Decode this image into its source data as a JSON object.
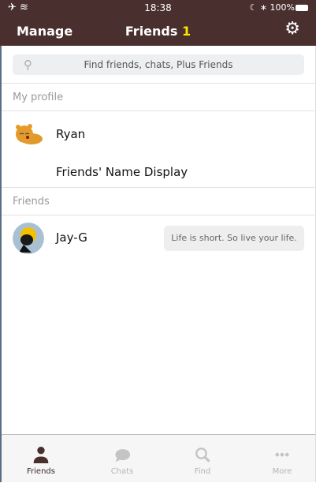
{
  "status_bar": {
    "time": "18:38",
    "battery": "100%"
  },
  "header": {
    "manage": "Manage",
    "title": "Friends",
    "count": "1",
    "accent": "#ffe600",
    "bg": "#4a2f2f"
  },
  "search": {
    "placeholder": "Find friends, chats, Plus Friends"
  },
  "my_profile": {
    "section": "My profile",
    "name": "Ryan",
    "option": "Friends' Name Display"
  },
  "friends": {
    "section": "Friends",
    "items": [
      {
        "name": "Jay-G",
        "status": "Life is short. So live your life."
      }
    ]
  },
  "tabs": [
    {
      "label": "Friends",
      "icon": "person-icon",
      "active": true
    },
    {
      "label": "Chats",
      "icon": "speech-bubble-icon"
    },
    {
      "label": "Find",
      "icon": "search-icon"
    },
    {
      "label": "More",
      "icon": "more-icon"
    }
  ]
}
